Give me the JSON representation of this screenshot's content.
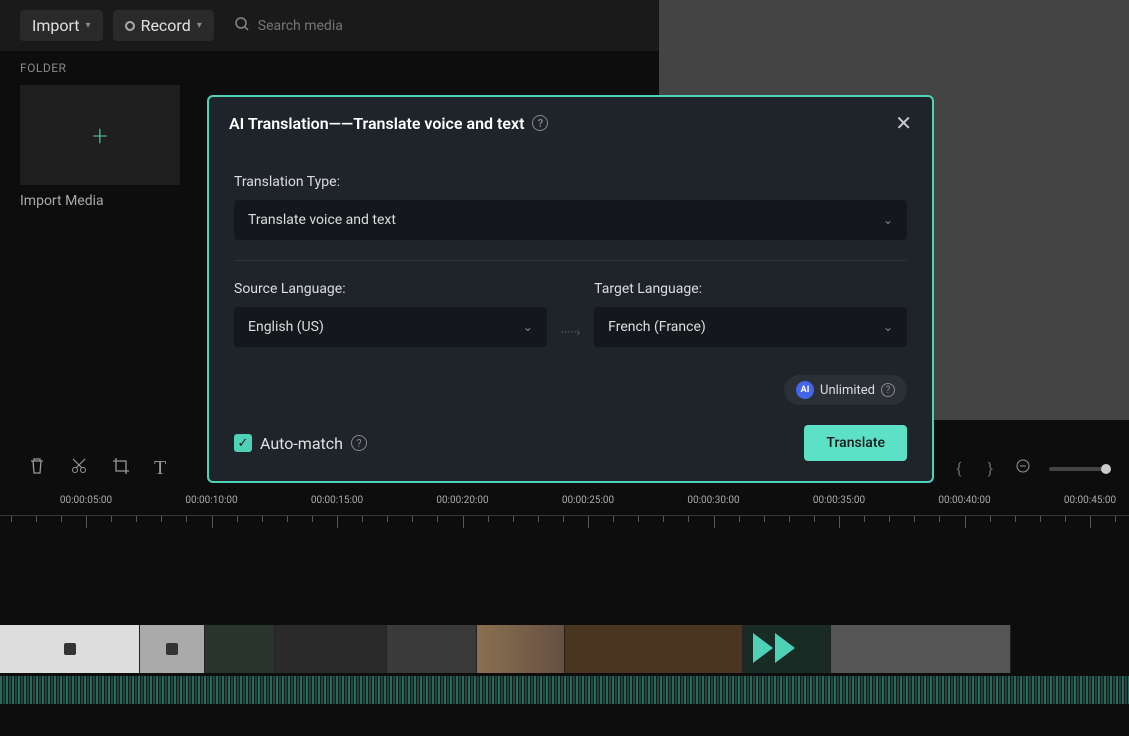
{
  "toolbar": {
    "import_label": "Import",
    "record_label": "Record",
    "search_placeholder": "Search media"
  },
  "folder": {
    "section_label": "FOLDER",
    "import_media_label": "Import Media"
  },
  "modal": {
    "title": "AI Translation——Translate voice and text",
    "translation_type_label": "Translation Type:",
    "translation_type_value": "Translate voice and text",
    "source_lang_label": "Source Language:",
    "source_lang_value": "English (US)",
    "target_lang_label": "Target Language:",
    "target_lang_value": "French (France)",
    "badge_ai": "AI",
    "badge_text": "Unlimited",
    "auto_match_label": "Auto-match",
    "translate_btn": "Translate"
  },
  "ruler": {
    "labels": [
      "00:00:05:00",
      "00:00:10:00",
      "00:00:15:00",
      "00:00:20:00",
      "00:00:25:00",
      "00:00:30:00",
      "00:00:35:00",
      "00:00:40:00",
      "00:00:45:00"
    ]
  }
}
